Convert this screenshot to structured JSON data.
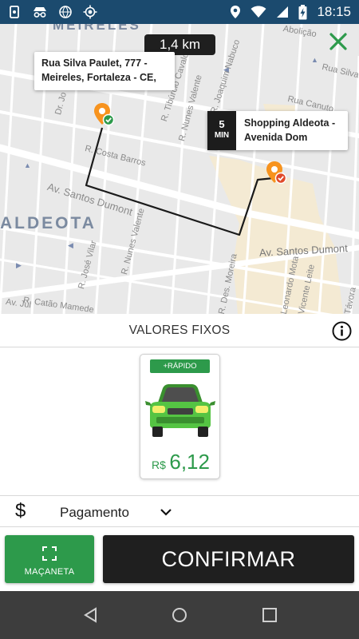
{
  "status_bar": {
    "time": "18:15",
    "icons": [
      "screen-mirror-icon",
      "incognito-icon",
      "globe-icon",
      "gps-icon",
      "location-icon",
      "wifi-icon",
      "signal-icon",
      "battery-charging-icon"
    ],
    "background": "#1b4a6e"
  },
  "map": {
    "distance": "1,4 km",
    "origin_address": "Rua Silva Paulet, 777 - Meireles, Fortaleza - CE,",
    "destination": {
      "eta_value": "5",
      "eta_unit": "MIN",
      "name": "Shopping Aldeota - Avenida Dom"
    },
    "street_labels": {
      "meireles": "MEIRELES",
      "aldeota": "ALDEOTA",
      "av_santos_dumont_left": "Av. Santos Dumont",
      "av_santos_dumont_right": "Av. Santos Dumont",
      "costa_barros": "R. Costa Barros",
      "tiburcio": "R. Tibúrcio Cavalcante",
      "joaquim_nabuco": "R. Joaquim Nabuco",
      "canuto": "Rua Canuto",
      "silva": "Rua Silva",
      "abolicao": "Abolição",
      "nunes_valente_1": "R. Nunes Valente",
      "nunes_valente_2": "R. Nunes Valente",
      "jose_vilar": "R. José Vilar",
      "catao_mamede": "R. Catão Mamede",
      "des_moreira": "R. Des. Moreira",
      "leonardo_mota": "Leonardo Mota",
      "vicente_leite": "Vicente Leite",
      "tavora": "Távora",
      "dr_jose": "Dr. Jo",
      "av_jul": "Av. Júl"
    },
    "pin_color": "#f7931e",
    "route_color": "#1a1a1a"
  },
  "panel": {
    "title": "VALORES FIXOS",
    "car_option": {
      "badge": "+RÁPIDO",
      "currency": "R$",
      "price": "6,12"
    },
    "payment_label": "Pagamento",
    "macaneta_label": "MAÇANETA",
    "confirm_label": "CONFIRMAR",
    "accent": "#2d9a4b"
  }
}
